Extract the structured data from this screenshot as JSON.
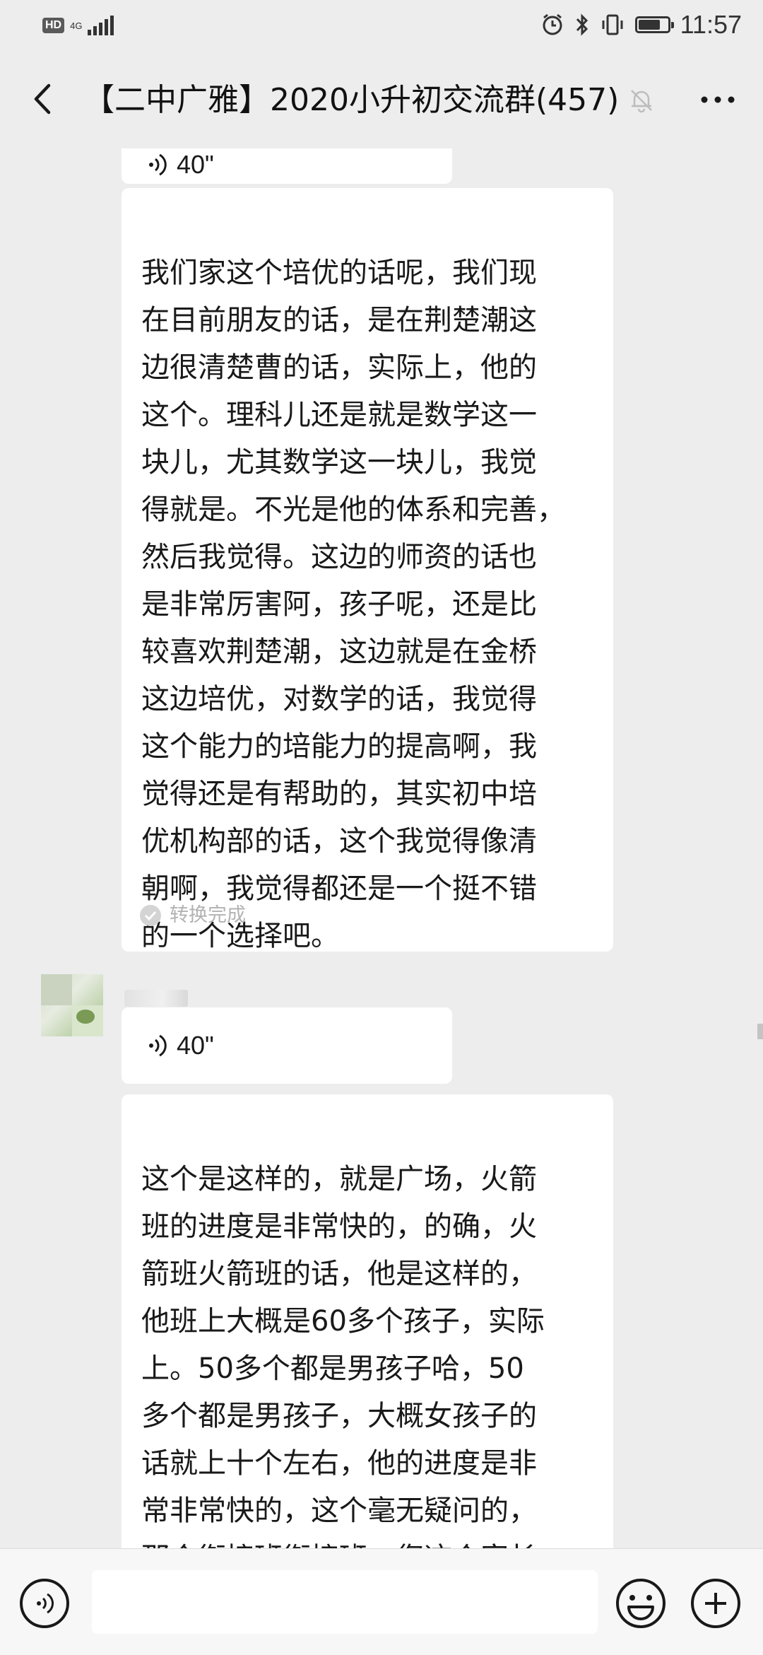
{
  "status_bar": {
    "hd": "HD",
    "network": "4G",
    "time": "11:57",
    "battery_level": 0.75
  },
  "header": {
    "title": "【二中广雅】2020小升初交流群(457)",
    "icons": {
      "back": "back-arrow-icon",
      "mute": "bell-muted-icon",
      "more": "more-dots-icon"
    }
  },
  "messages": [
    {
      "type": "voice",
      "duration": "40\""
    },
    {
      "type": "voice-text",
      "text": "我们家这个培优的话呢，我们现\n在目前朋友的话，是在荆楚潮这\n边很清楚曹的话，实际上，他的\n这个。理科儿还是就是数学这一\n块儿，尤其数学这一块儿，我觉\n得就是。不光是他的体系和完善，\n然后我觉得。这边的师资的话也\n是非常厉害阿，孩子呢，还是比\n较喜欢荆楚潮，这边就是在金桥\n这边培优，对数学的话，我觉得\n这个能力的培能力的提高啊，我\n觉得还是有帮助的，其实初中培\n优机构部的话，这个我觉得像清\n朝啊，我觉得都还是一个挺不错\n的一个选择吧。",
      "status": "转换完成"
    },
    {
      "type": "voice",
      "duration": "40\""
    },
    {
      "type": "voice-text",
      "text": "这个是这样的，就是广场，火箭\n班的进度是非常快的，的确，火\n箭班火箭班的话，他是这样的，\n他班上大概是60多个孩子，实际\n上。50多个都是男孩子哈，50\n多个都是男孩子，大概女孩子的\n话就上十个左右，他的进度是非\n常非常快的，这个毫无疑问的，\n那个衔接班衔接班，您这个家长\n问的衔接班，一是什么意思，衔"
    }
  ],
  "input_bar": {
    "text_value": "",
    "icons": {
      "voice": "voice-input-icon",
      "emoji": "emoji-icon",
      "plus": "plus-icon"
    }
  }
}
